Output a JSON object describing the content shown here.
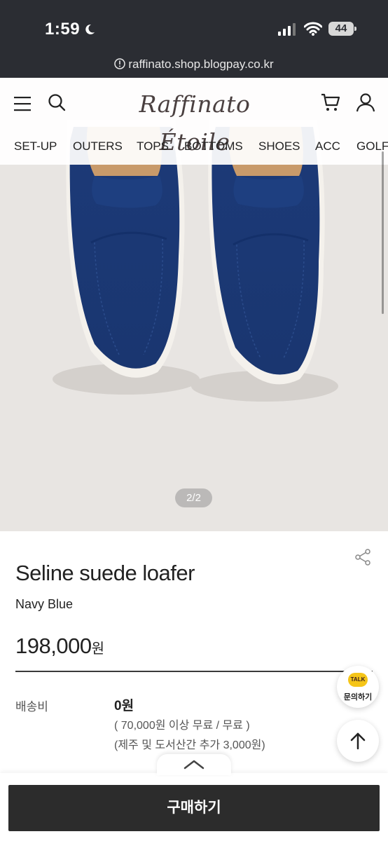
{
  "status_bar": {
    "time": "1:59",
    "battery": "44"
  },
  "browser": {
    "url": "raffinato.shop.blogpay.co.kr"
  },
  "header": {
    "logo": "Raffinato Étoile",
    "nav": [
      "SET-UP",
      "OUTERS",
      "TOPS",
      "BOTTOMS",
      "SHOES",
      "ACC",
      "GOLF"
    ]
  },
  "gallery": {
    "pager": "2/2"
  },
  "product": {
    "title": "Seline suede loafer",
    "color": "Navy Blue",
    "price": "198,000",
    "price_unit": "원"
  },
  "shipping": {
    "label": "배송비",
    "fee": "0원",
    "note1": "( 70,000원 이상 무료 / 무료 )",
    "note2": "(제주 및 도서산간 추가 3,000원)"
  },
  "floating": {
    "talk_badge": "TALK",
    "talk_label": "문의하기"
  },
  "actions": {
    "buy": "구매하기"
  },
  "colors": {
    "status_bg": "#2b2d33",
    "hero_bg": "#e8e5e2",
    "shoe": "#1f3d7a",
    "buy_bg": "#2c2c2c",
    "kakao": "#f5c518"
  }
}
